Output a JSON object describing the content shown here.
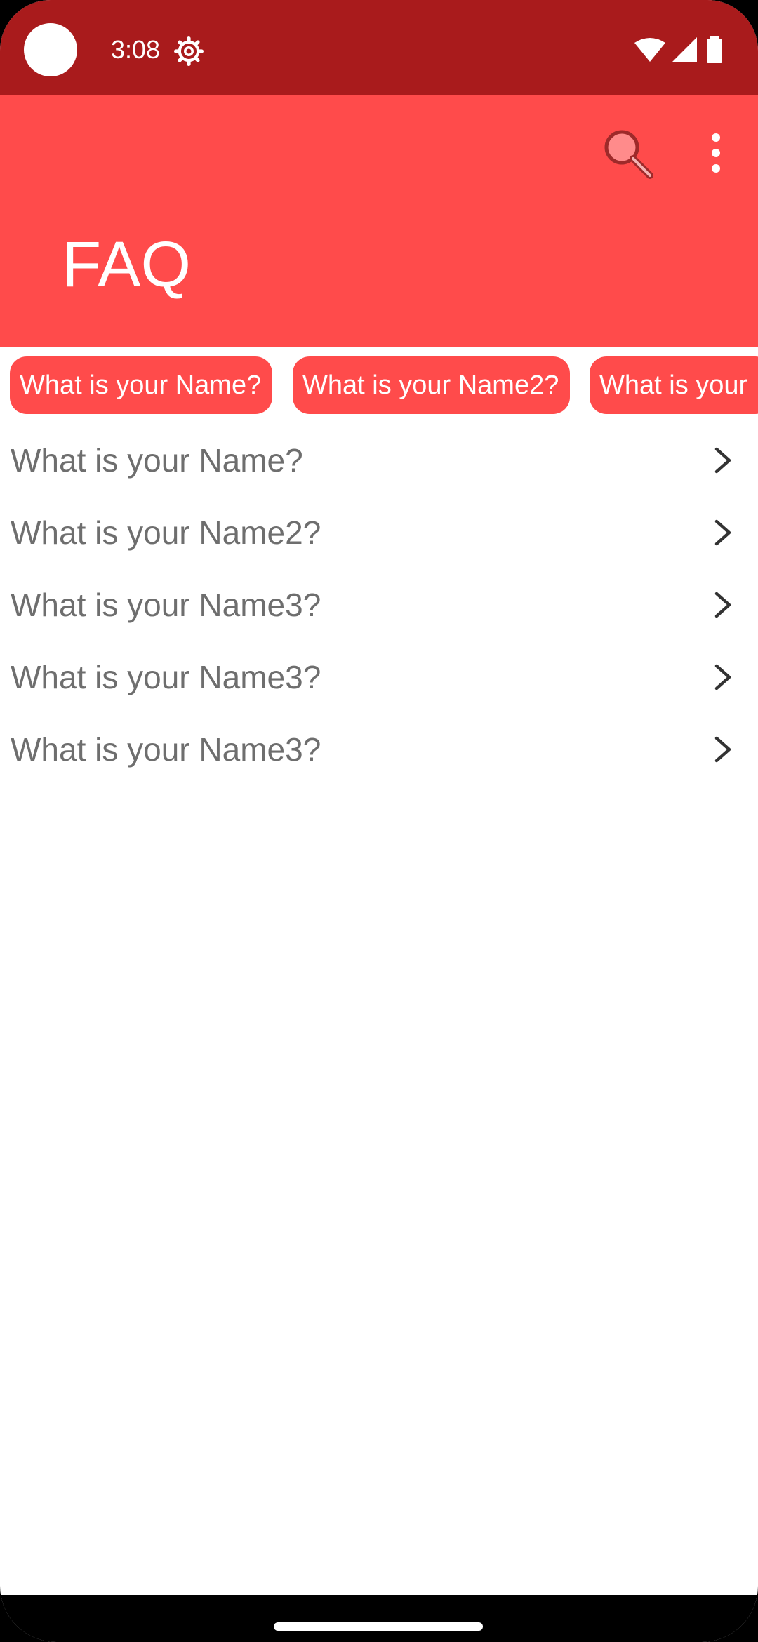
{
  "status_bar": {
    "time": "3:08",
    "icons": [
      "settings-gear-icon",
      "wifi-icon",
      "cellular-signal-icon",
      "battery-icon"
    ]
  },
  "app_bar": {
    "title": "FAQ",
    "background_color": "#ff4b4b",
    "status_bar_color": "#a91b1c",
    "actions": [
      "search-icon",
      "more-vert-icon"
    ]
  },
  "chips": [
    {
      "label": "What is your Name?"
    },
    {
      "label": "What is your Name2?"
    },
    {
      "label": "What is your"
    }
  ],
  "faq": {
    "text_color": "#6e6e6e",
    "items": [
      {
        "question": "What is your Name?"
      },
      {
        "question": "What is your Name2?"
      },
      {
        "question": "What is your Name3?"
      },
      {
        "question": "What is your Name3?"
      },
      {
        "question": "What is your Name3?"
      }
    ]
  }
}
